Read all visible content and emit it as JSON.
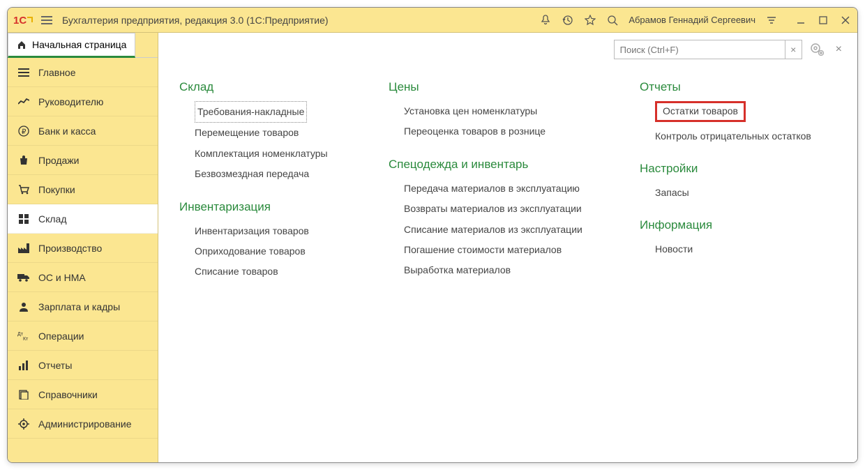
{
  "titlebar": {
    "title": "Бухгалтерия предприятия, редакция 3.0  (1С:Предприятие)",
    "user": "Абрамов Геннадий Сергеевич"
  },
  "tab": {
    "label": "Начальная страница"
  },
  "sidebar": {
    "items": [
      {
        "label": "Главное",
        "icon": "menu"
      },
      {
        "label": "Руководителю",
        "icon": "chart"
      },
      {
        "label": "Банк и касса",
        "icon": "ruble"
      },
      {
        "label": "Продажи",
        "icon": "bag"
      },
      {
        "label": "Покупки",
        "icon": "cart"
      },
      {
        "label": "Склад",
        "icon": "grid",
        "active": true
      },
      {
        "label": "Производство",
        "icon": "factory"
      },
      {
        "label": "ОС и НМА",
        "icon": "truck"
      },
      {
        "label": "Зарплата и кадры",
        "icon": "person"
      },
      {
        "label": "Операции",
        "icon": "dtkt"
      },
      {
        "label": "Отчеты",
        "icon": "bars"
      },
      {
        "label": "Справочники",
        "icon": "books"
      },
      {
        "label": "Администрирование",
        "icon": "settings"
      }
    ]
  },
  "search": {
    "placeholder": "Поиск (Ctrl+F)"
  },
  "columns": [
    {
      "sections": [
        {
          "title": "Склад",
          "links": [
            {
              "label": "Требования-накладные",
              "dotted": true
            },
            {
              "label": "Перемещение товаров"
            },
            {
              "label": "Комплектация номенклатуры"
            },
            {
              "label": "Безвозмездная передача"
            }
          ]
        },
        {
          "title": "Инвентаризация",
          "links": [
            {
              "label": "Инвентаризация товаров"
            },
            {
              "label": "Оприходование товаров"
            },
            {
              "label": "Списание товаров"
            }
          ]
        }
      ]
    },
    {
      "sections": [
        {
          "title": "Цены",
          "links": [
            {
              "label": "Установка цен номенклатуры"
            },
            {
              "label": "Переоценка товаров в рознице"
            }
          ]
        },
        {
          "title": "Спецодежда и инвентарь",
          "links": [
            {
              "label": "Передача материалов в эксплуатацию"
            },
            {
              "label": "Возвраты материалов из эксплуатации"
            },
            {
              "label": "Списание материалов из эксплуатации"
            },
            {
              "label": "Погашение стоимости материалов"
            },
            {
              "label": "Выработка материалов"
            }
          ]
        }
      ]
    },
    {
      "sections": [
        {
          "title": "Отчеты",
          "links": [
            {
              "label": "Остатки товаров",
              "highlight": true
            },
            {
              "label": "Контроль отрицательных остатков"
            }
          ]
        },
        {
          "title": "Настройки",
          "links": [
            {
              "label": "Запасы"
            }
          ]
        },
        {
          "title": "Информация",
          "links": [
            {
              "label": "Новости"
            }
          ]
        }
      ]
    }
  ]
}
